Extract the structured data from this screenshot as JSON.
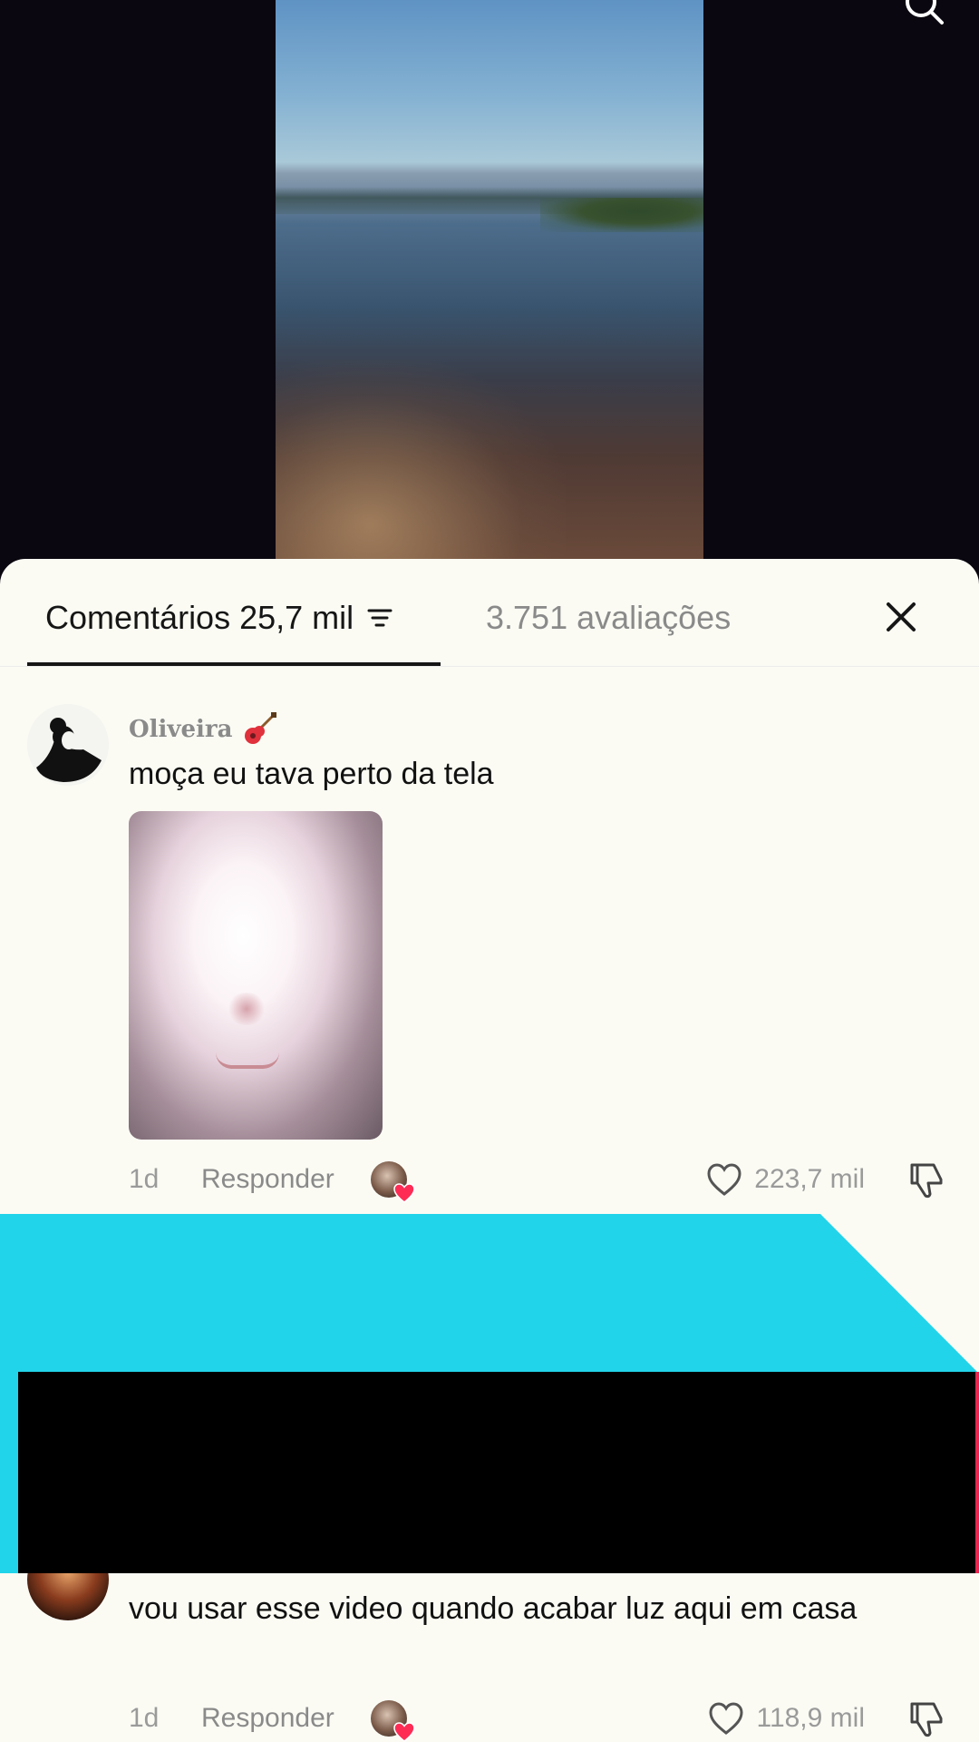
{
  "header": {
    "search_icon": "search-icon"
  },
  "tabs": {
    "comments_label": "Comentários 25,7 mil",
    "ratings_label": "3.751 avaliações",
    "filter_icon": "filter-icon",
    "close_icon": "close-icon"
  },
  "comments": [
    {
      "username": "Oliveira",
      "username_emoji": "guitar-icon",
      "text": "moça eu tava perto da tela",
      "has_image": true,
      "age": "1d",
      "reply_label": "Responder",
      "likes": "223,7 mil"
    },
    {
      "text": "vou usar esse video quando acabar luz aqui em casa",
      "age": "1d",
      "reply_label": "Responder",
      "likes": "118,9 mil"
    }
  ],
  "colors": {
    "sheet_bg": "#fbfbf4",
    "overlay_cyan": "#22d4ea",
    "overlay_black": "#000000",
    "heart_red": "#fe2c55"
  }
}
